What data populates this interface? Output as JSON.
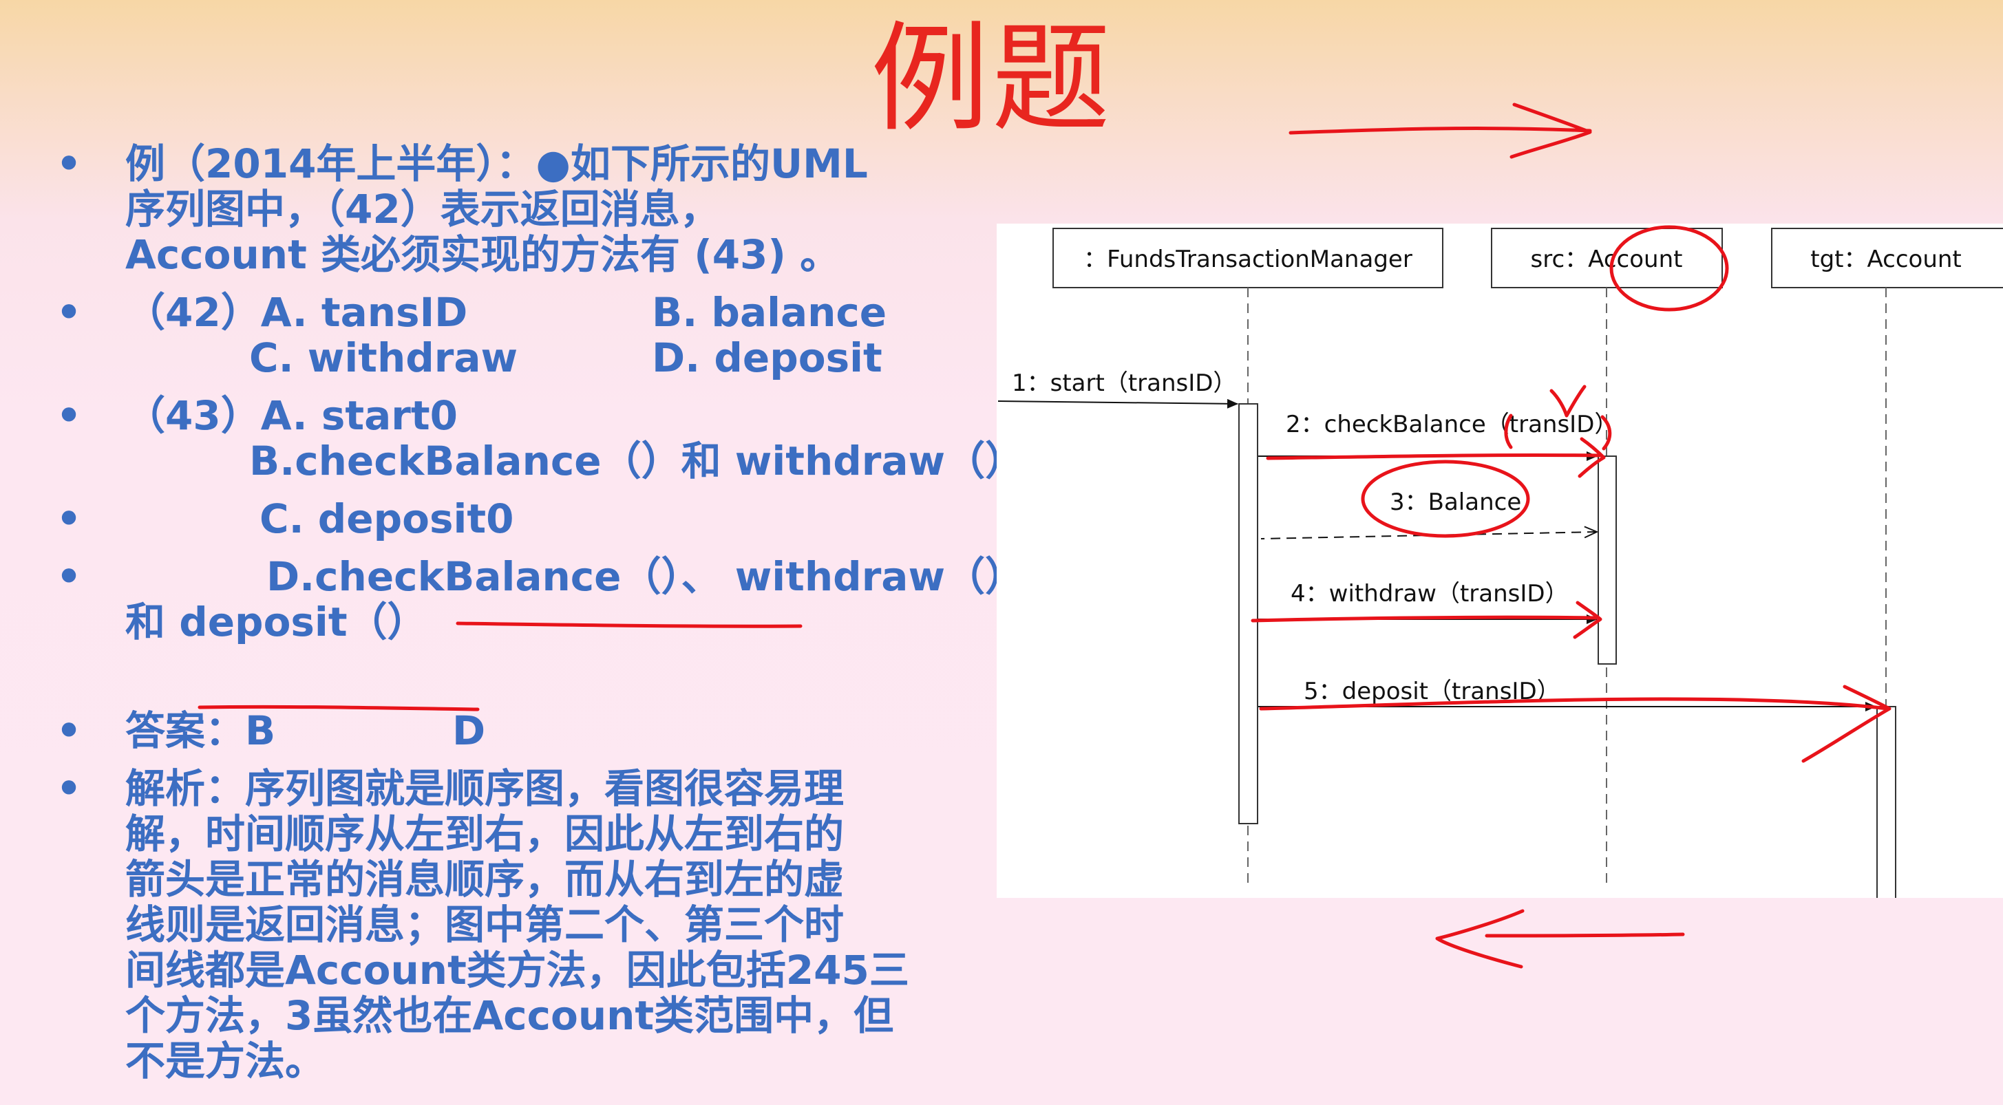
{
  "slide": {
    "title": "例题",
    "bullets": [
      {
        "lines": [
          "例（2014年上半年）：●如下所示的UML",
          "序列图中，（42）表示返回消息，",
          "Account 类必须实现的方法有 (43) 。"
        ]
      },
      {
        "q42": {
          "a": "（42）A.  tansID",
          "b": "B. balance",
          "c": "C. withdraw",
          "d": "D. deposit"
        }
      },
      {
        "q43": {
          "a": "（43）A.  start0",
          "b": "B.checkBalance（）和 withdraw（）"
        }
      },
      {
        "c": "C.  deposit0"
      },
      {
        "d1": "D.checkBalance（）、 withdraw（）",
        "d2": "和 deposit（）"
      },
      {
        "answer": "答案：B",
        "answer_d": "D"
      },
      {
        "lines": [
          "解析：序列图就是顺序图，看图很容易理",
          "解，时间顺序从左到右，因此从左到右的",
          "箭头是正常的消息顺序，而从右到左的虚",
          "线则是返回消息；图中第二个、第三个时",
          "间线都是Account类方法，因此包括245三",
          "个方法，3虽然也在Account类范围中，但",
          "不是方法。"
        ]
      }
    ]
  },
  "diagram": {
    "lifelines": [
      {
        "label": "：FundsTransactionManager"
      },
      {
        "label": "src：Account"
      },
      {
        "label": "tgt：Account"
      }
    ],
    "messages": [
      {
        "label": "1：start（transID）"
      },
      {
        "label": "2：checkBalance（transID）"
      },
      {
        "label": "3：Balance"
      },
      {
        "label": "4：withdraw（transID）"
      },
      {
        "label": "5：deposit（transID）"
      }
    ]
  },
  "colors": {
    "text": "#3c6ec2",
    "title": "#e8261f",
    "annotation": "#e8131a"
  }
}
